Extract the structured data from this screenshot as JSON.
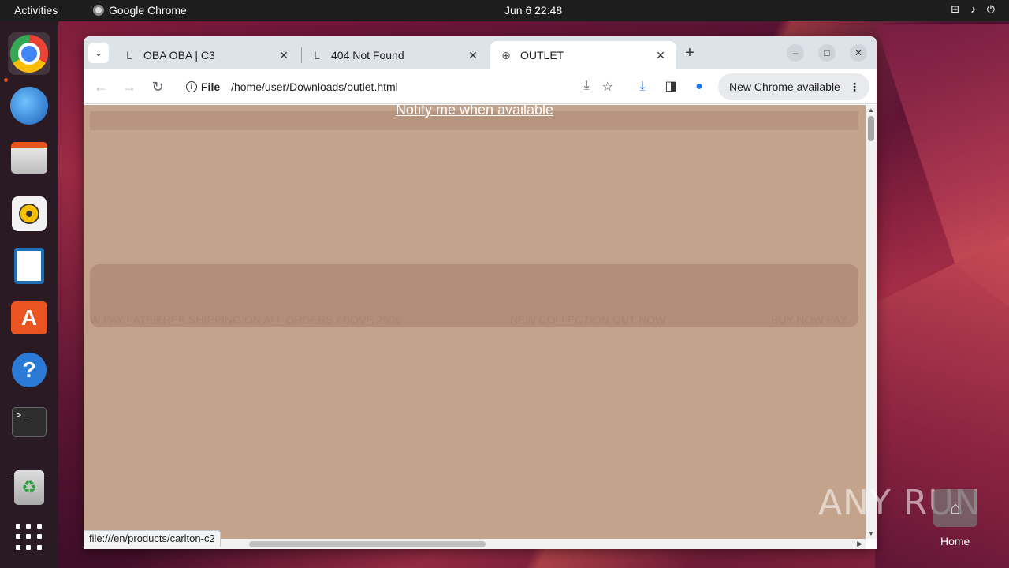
{
  "topbar": {
    "activities": "Activities",
    "app_name": "Google Chrome",
    "clock": "Jun 6  22:48",
    "tray_icons": [
      "network-icon",
      "volume-icon",
      "power-icon"
    ]
  },
  "dock": {
    "items": [
      {
        "name": "chrome",
        "icon": "chrome-icon",
        "active": true
      },
      {
        "name": "thunderbird",
        "icon": "thunderbird-icon"
      },
      {
        "name": "files",
        "icon": "files-icon"
      },
      {
        "name": "rhythmbox",
        "icon": "rhythmbox-icon"
      },
      {
        "name": "writer",
        "icon": "writer-icon"
      },
      {
        "name": "app-center",
        "icon": "app-store-icon"
      },
      {
        "name": "help",
        "icon": "help-icon"
      },
      {
        "name": "terminal",
        "icon": "terminal-icon"
      },
      {
        "name": "trash",
        "icon": "trash-icon"
      },
      {
        "name": "show-apps",
        "icon": "app-grid-icon"
      }
    ],
    "terminal_glyph": ">_",
    "help_glyph": "?",
    "store_glyph": "A",
    "trash_glyph": "♻"
  },
  "browser": {
    "tabs": [
      {
        "title": "OBA OBA | C3",
        "favicon": "L",
        "active": false
      },
      {
        "title": "404 Not Found",
        "favicon": "L",
        "active": false
      },
      {
        "title": "OUTLET",
        "favicon": "globe-icon",
        "active": true
      }
    ],
    "new_tab": "+",
    "close_glyph": "✕",
    "omnibox": {
      "scheme": "File",
      "url": "/home/user/Downloads/outlet.html"
    },
    "update_button": "New Chrome available",
    "status_url": "file:///en/products/carlton-c2"
  },
  "page": {
    "notify_link": "Notify me when available",
    "marquee": [
      "W PAY LATER",
      "FREE SHIPPING ON ALL ORDERS ABOVE 250€",
      "NEW COLLECTION OUT NOW",
      "BUY NOW PAY"
    ],
    "background_color": "#c4a38c"
  },
  "desktop": {
    "watermark": "ANY RUN",
    "home_label": "Home"
  }
}
